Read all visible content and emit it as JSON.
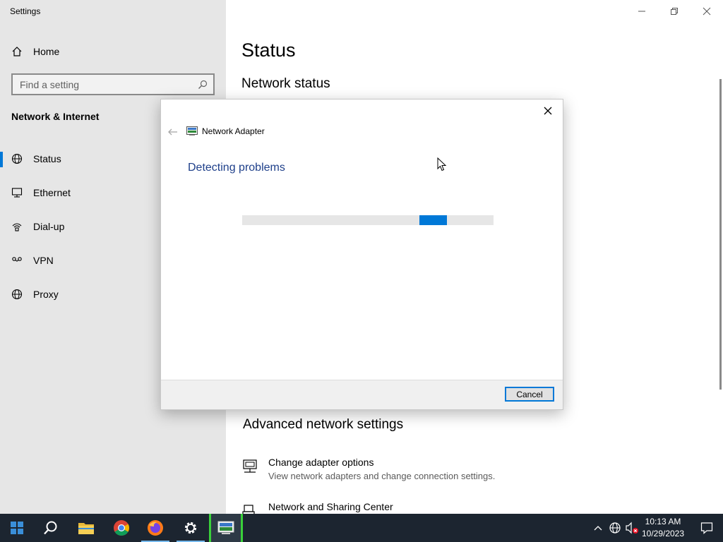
{
  "window": {
    "title": "Settings"
  },
  "sidebar": {
    "home_label": "Home",
    "search_placeholder": "Find a setting",
    "section_title": "Network & Internet",
    "items": [
      {
        "label": "Status",
        "icon": "globe-icon",
        "active": true
      },
      {
        "label": "Ethernet",
        "icon": "ethernet-icon"
      },
      {
        "label": "Dial-up",
        "icon": "dialup-icon"
      },
      {
        "label": "VPN",
        "icon": "vpn-icon"
      },
      {
        "label": "Proxy",
        "icon": "proxy-globe-icon"
      }
    ]
  },
  "main": {
    "title": "Status",
    "network_status_heading": "Network status",
    "advanced_heading": "Advanced network settings",
    "advanced_items": [
      {
        "title": "Change adapter options",
        "desc": "View network adapters and change connection settings.",
        "icon": "adapter-icon"
      },
      {
        "title": "Network and Sharing Center",
        "desc": "",
        "icon": "sharing-center-icon"
      }
    ]
  },
  "dialog": {
    "app_name": "Network Adapter",
    "status_text": "Detecting problems",
    "progress": {
      "indeterminate": true,
      "segment_start": 0.705,
      "segment_end": 0.815
    },
    "cancel_label": "Cancel"
  },
  "taskbar": {
    "apps": [
      "start-icon",
      "search-icon",
      "file-explorer-icon",
      "chrome-icon",
      "firefox-icon",
      "settings-icon",
      "network-troubleshooter-icon"
    ],
    "clock_time": "10:13 AM",
    "clock_date": "10/29/2023"
  },
  "colors": {
    "accent": "#0078d7",
    "link_text": "#1e3f8a",
    "sidebar_bg": "#e6e6e6",
    "taskbar_bg": "#1c2530"
  }
}
